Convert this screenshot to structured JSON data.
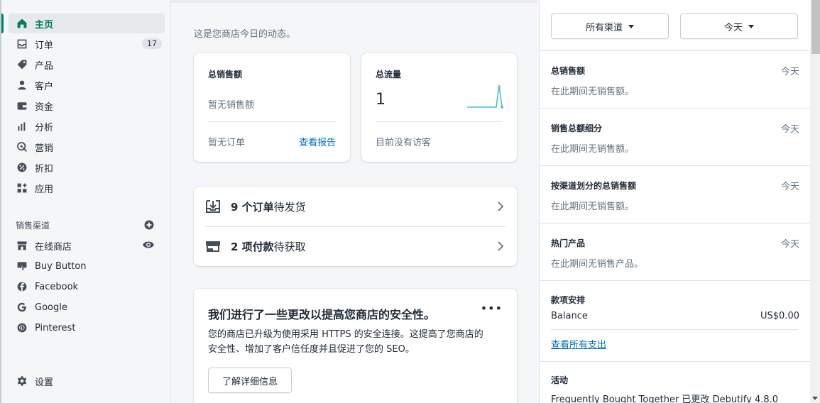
{
  "sidebar": {
    "items": [
      {
        "label": "主页",
        "icon": "home-icon"
      },
      {
        "label": "订单",
        "icon": "inbox-icon",
        "badge": "17"
      },
      {
        "label": "产品",
        "icon": "tag-icon"
      },
      {
        "label": "客户",
        "icon": "person-icon"
      },
      {
        "label": "资金",
        "icon": "wallet-icon"
      },
      {
        "label": "分析",
        "icon": "bar-chart-icon"
      },
      {
        "label": "营销",
        "icon": "target-icon"
      },
      {
        "label": "折扣",
        "icon": "discount-icon"
      },
      {
        "label": "应用",
        "icon": "apps-icon"
      }
    ],
    "channels_title": "销售渠道",
    "channels": [
      {
        "label": "在线商店",
        "icon": "store-icon"
      },
      {
        "label": "Buy Button",
        "icon": "buy-button-icon"
      },
      {
        "label": "Facebook",
        "icon": "facebook-icon"
      },
      {
        "label": "Google",
        "icon": "google-icon"
      },
      {
        "label": "Pinterest",
        "icon": "pinterest-icon"
      }
    ],
    "settings_label": "设置"
  },
  "main": {
    "subtitle": "这是您商店今日的动态。",
    "sales_card": {
      "title": "总销售额",
      "value": "暂无销售额",
      "orders": "暂无订单",
      "link": "查看报告"
    },
    "traffic_card": {
      "title": "总流量",
      "value": "1",
      "footer": "目前没有访客"
    },
    "tasks": [
      {
        "bold": "9 个订单",
        "rest": "待发货"
      },
      {
        "bold": "2 项付款",
        "rest": "待获取"
      }
    ],
    "security": {
      "title": "我们进行了一些更改以提高您商店的安全性。",
      "body": "您的商店已升级为使用采用 HTTPS 的安全连接。这提高了您商店的安全性、增加了客户信任度并且促进了您的 SEO。",
      "button": "了解详细信息",
      "more": "•••"
    }
  },
  "right_panel": {
    "channel_select": "所有渠道",
    "date_select": "今天",
    "sections": [
      {
        "title": "总销售额",
        "period": "今天",
        "text": "在此期间无销售额。"
      },
      {
        "title": "销售总额细分",
        "period": "今天",
        "text": "在此期间无销售额。"
      },
      {
        "title": "按渠道划分的总销售额",
        "period": "今天",
        "text": "在此期间无销售额。"
      },
      {
        "title": "热门产品",
        "period": "今天",
        "text": "在此期间无销售产品。"
      }
    ],
    "payouts": {
      "title": "款项安排",
      "balance_label": "Balance",
      "balance_value": "US$0.00",
      "link": "查看所有支出"
    },
    "activity": {
      "title": "活动",
      "item": "Frequently Bought Together 已更改 Debutify 4.8.0"
    }
  },
  "colors": {
    "accent": "#008060",
    "link": "#006fbb",
    "sparkline": "#47c1bf"
  }
}
